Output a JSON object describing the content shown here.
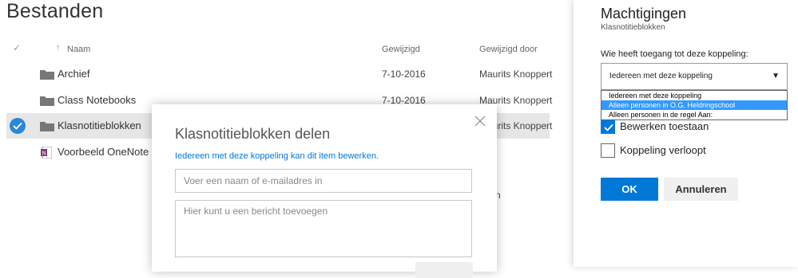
{
  "page": {
    "title": "Bestanden"
  },
  "list": {
    "columns": {
      "name": "Naam",
      "modified": "Gewijzigd",
      "modified_by": "Gewijzigd door"
    },
    "rows": [
      {
        "name": "Archief",
        "modified": "7-10-2016",
        "modified_by": "Maurits Knoppert",
        "icon": "folder-icon"
      },
      {
        "name": "Class Notebooks",
        "modified": "7-10-2016",
        "modified_by": "Maurits Knoppert",
        "icon": "folder-icon"
      },
      {
        "name": "Klasnotitieblokken",
        "modified": "",
        "modified_by": "Maurits Knoppert",
        "icon": "folder-icon",
        "selected": true
      },
      {
        "name": "Voorbeeld OneNote n",
        "modified": "",
        "modified_by": "",
        "icon": "onenote-icon"
      }
    ],
    "partial_text": "n"
  },
  "share_dialog": {
    "title": "Klasnotitieblokken delen",
    "link_text": "Iedereen met deze koppeling kan dit item bewerken.",
    "recipient_placeholder": "Voer een naam of e-mailadres in",
    "message_placeholder": "Hier kunt u een bericht toevoegen"
  },
  "permissions_panel": {
    "title": "Machtigingen",
    "subtitle": "Klasnotitieblokken",
    "access_label": "Wie heeft toegang tot deze koppeling:",
    "access_selected": "Iedereen met deze koppeling",
    "access_options": [
      "Iedereen met deze koppeling",
      "Alleen personen in O.G. Heldringschool",
      "Alleen personen in de regel Aan:"
    ],
    "highlighted_option": 1,
    "allow_edit_label": "Bewerken toestaan",
    "allow_edit_checked": true,
    "link_expires_label": "Koppeling verloopt",
    "link_expires_checked": false,
    "ok_label": "OK",
    "cancel_label": "Annuleren"
  },
  "colors": {
    "accent": "#0078d7",
    "selected_row": "#e6e6e6",
    "highlight": "#3399ff"
  }
}
